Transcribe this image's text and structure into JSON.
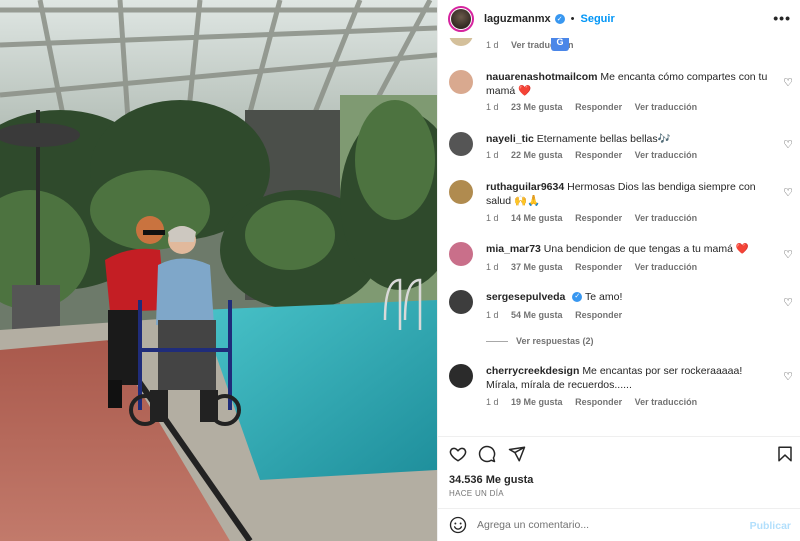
{
  "header": {
    "username": "laguzmanmx",
    "separator": "•",
    "follow_label": "Seguir",
    "more_icon": "more-horizontal-icon"
  },
  "partial_comment": {
    "meta_time": "1 d",
    "meta_translate": "Ver traducción",
    "translate_badge": "G"
  },
  "comments": [
    {
      "username": "nauarenashotmailcom",
      "text": "Me encanta cómo compartes con tu mamá",
      "emoji": "❤️",
      "time": "1 d",
      "likes": "23 Me gusta",
      "reply": "Responder",
      "translate": "Ver traducción",
      "verified": false,
      "avatar_color": "#d9a98f"
    },
    {
      "username": "nayeli_tic",
      "text": "Eternamente bellas bellas",
      "emoji": "🎶",
      "time": "1 d",
      "likes": "22 Me gusta",
      "reply": "Responder",
      "translate": "Ver traducción",
      "verified": false,
      "avatar_color": "#555555"
    },
    {
      "username": "ruthaguilar9634",
      "text": "Hermosas Dios las bendiga siempre con salud",
      "emoji": "🙌🙏",
      "time": "1 d",
      "likes": "14 Me gusta",
      "reply": "Responder",
      "translate": "Ver traducción",
      "verified": false,
      "avatar_color": "#b08b4f"
    },
    {
      "username": "mia_mar73",
      "text": "Una bendicion de que tengas a tu mamá",
      "emoji": "❤️",
      "time": "1 d",
      "likes": "37 Me gusta",
      "reply": "Responder",
      "translate": "Ver traducción",
      "verified": false,
      "avatar_color": "#c96f8a"
    },
    {
      "username": "sergesepulveda",
      "text": "Te amo!",
      "emoji": "",
      "time": "1 d",
      "likes": "54 Me gusta",
      "reply": "Responder",
      "translate": "",
      "verified": true,
      "avatar_color": "#3d3d3d",
      "replies_label": "Ver respuestas (2)"
    },
    {
      "username": "cherrycreekdesign",
      "text": "Me encantas por ser rockeraaaaa! Mírala, mírala de recuerdos......",
      "emoji": "",
      "time": "1 d",
      "likes": "19 Me gusta",
      "reply": "Responder",
      "translate": "Ver traducción",
      "verified": false,
      "avatar_color": "#2b2b2b"
    }
  ],
  "actions": {
    "like_icon": "heart-icon",
    "comment_icon": "comment-icon",
    "share_icon": "share-icon",
    "save_icon": "bookmark-icon"
  },
  "post": {
    "likes": "34.536 Me gusta",
    "time_ago": "HACE UN DÍA"
  },
  "add_comment": {
    "placeholder": "Agrega un comentario...",
    "publish_label": "Publicar",
    "emoji_icon": "smiley-icon"
  }
}
